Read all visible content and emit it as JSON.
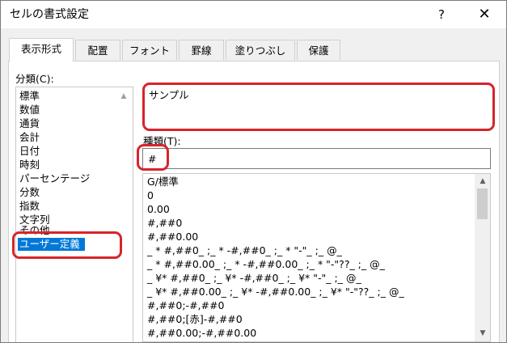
{
  "window": {
    "title": "セルの書式設定",
    "help_glyph": "?",
    "close_glyph": "✕"
  },
  "tabs": [
    {
      "label": "表示形式",
      "active": true
    },
    {
      "label": "配置"
    },
    {
      "label": "フォント"
    },
    {
      "label": "罫線"
    },
    {
      "label": "塗りつぶし"
    },
    {
      "label": "保護"
    }
  ],
  "category": {
    "label": "分類(C):",
    "items": [
      "標準",
      "数値",
      "通貨",
      "会計",
      "日付",
      "時刻",
      "パーセンテージ",
      "分数",
      "指数",
      "文字列",
      "その他",
      "ユーザー定義"
    ],
    "selected": "ユーザー定義"
  },
  "sample": {
    "label": "サンプル"
  },
  "type_field": {
    "label": "種類(T):",
    "value": "#"
  },
  "format_list": [
    "G/標準",
    "0",
    "0.00",
    "#,##0",
    "#,##0.00",
    "_ * #,##0_ ;_ * -#,##0_ ;_ * \"-\"_ ;_ @_",
    "_ * #,##0.00_ ;_ * -#,##0.00_ ;_ * \"-\"??_ ;_ @_",
    "_ ¥* #,##0_ ;_ ¥* -#,##0_ ;_ ¥* \"-\"_ ;_ @_",
    "_ ¥* #,##0.00_ ;_ ¥* -#,##0.00_ ;_ ¥* \"-\"??_ ;_ @_",
    "#,##0;-#,##0",
    "#,##0;[赤]-#,##0",
    "#,##0.00;-#,##0.00"
  ],
  "colors": {
    "highlight": "#d6242b",
    "selection": "#0078d7",
    "dialog_bg": "#f0f0f0"
  }
}
